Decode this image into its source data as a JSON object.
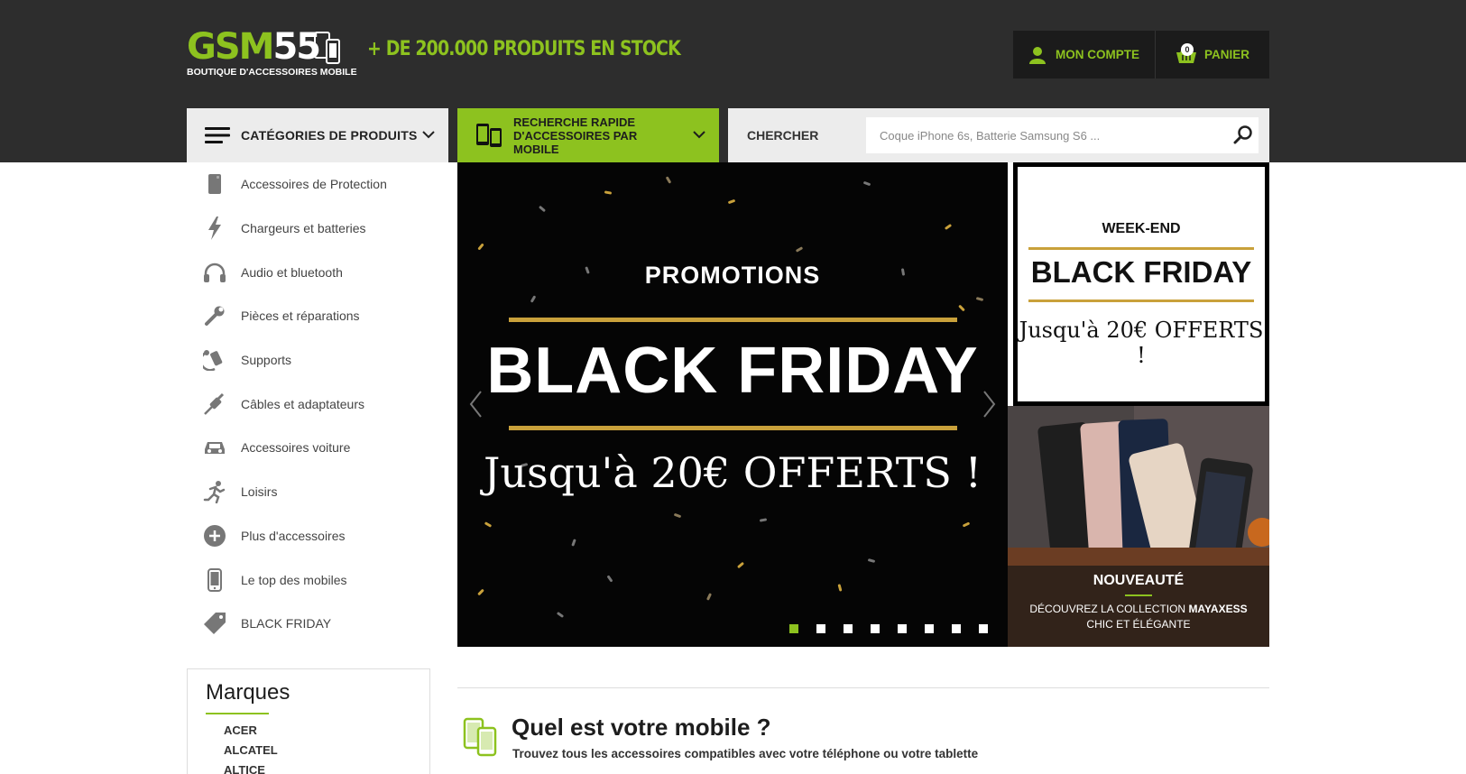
{
  "header": {
    "logo_left": "GSM",
    "logo_right": "55",
    "logo_sub": "BOUTIQUE D'ACCESSOIRES MOBILE",
    "tagline": "+ DE 200.000 PRODUITS EN STOCK",
    "account_label": "MON COMPTE",
    "cart_label": "PANIER",
    "cart_count": "0"
  },
  "nav": {
    "categories_label": "CATÉGORIES DE PRODUITS",
    "quick_search_label": "RECHERCHE RAPIDE D'ACCESSOIRES PAR MOBILE",
    "search_label": "CHERCHER",
    "search_placeholder": "Coque iPhone 6s, Batterie Samsung S6 ..."
  },
  "categories": [
    {
      "label": "Accessoires de Protection",
      "icon": "phone-case-icon"
    },
    {
      "label": "Chargeurs et batteries",
      "icon": "lightning-icon"
    },
    {
      "label": "Audio et bluetooth",
      "icon": "headphones-icon"
    },
    {
      "label": "Pièces et réparations",
      "icon": "wrench-icon"
    },
    {
      "label": "Supports",
      "icon": "support-icon"
    },
    {
      "label": "Câbles et adaptateurs",
      "icon": "cable-icon"
    },
    {
      "label": "Accessoires voiture",
      "icon": "car-icon"
    },
    {
      "label": "Loisirs",
      "icon": "runner-icon"
    },
    {
      "label": "Plus d'accessoires",
      "icon": "plus-circle-icon"
    },
    {
      "label": "Le top des mobiles",
      "icon": "smartphone-icon"
    },
    {
      "label": "BLACK FRIDAY",
      "icon": "tag-icon"
    }
  ],
  "marques": {
    "title": "Marques",
    "items": [
      "ACER",
      "ALCATEL",
      "ALTICE"
    ]
  },
  "banner": {
    "promo": "PROMOTIONS",
    "title": "BLACK FRIDAY",
    "offer": "Jusqu'à 20€ OFFERTS !",
    "slide_count": 8,
    "active_slide": 1
  },
  "side_banner_1": {
    "kicker": "WEEK-END",
    "title": "BLACK FRIDAY",
    "offer": "Jusqu'à 20€ OFFERTS !"
  },
  "side_banner_2": {
    "title": "NOUVEAUTÉ",
    "line1_prefix": "DÉCOUVREZ LA COLLECTION ",
    "line1_brand": "MAYAXESS",
    "line2": "CHIC ET ÉLÉGANTE"
  },
  "mobile_section": {
    "title": "Quel est votre mobile ?",
    "subtitle": "Trouvez tous les accessoires compatibles avec votre téléphone ou votre tablette"
  },
  "colors": {
    "brand_green": "#8dc21f",
    "header_bg": "#2d2d2d",
    "gold": "#c9a13b"
  }
}
